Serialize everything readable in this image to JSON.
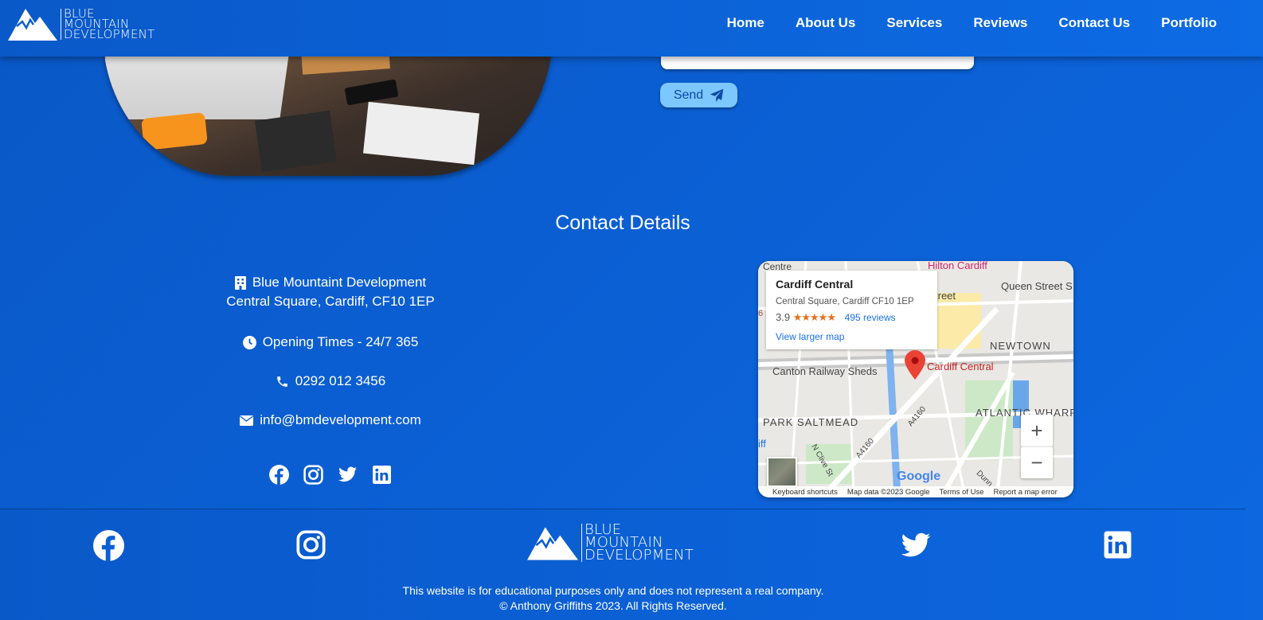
{
  "brand": {
    "line1": "BLUE",
    "line2": "MOUNTAIN",
    "line3": "DEVELOPMENT"
  },
  "nav": {
    "items": [
      "Home",
      "About Us",
      "Services",
      "Reviews",
      "Contact Us",
      "Portfolio"
    ]
  },
  "form": {
    "send_label": "Send"
  },
  "contact": {
    "title": "Contact Details",
    "company": "Blue Mountaint Development",
    "address": "Central Square, Cardiff, CF10 1EP",
    "opening": "Opening Times - 24/7 365",
    "phone": "0292 012 3456",
    "email": "info@bmdevelopment.com"
  },
  "map": {
    "place_name": "Cardiff Central",
    "place_address": "Central Square, Cardiff CF10 1EP",
    "rating": "3.9",
    "stars": "★★★★★",
    "reviews": "495 reviews",
    "larger_map": "View larger map",
    "labels": {
      "hilton": "Hilton Cardiff",
      "queen_street": "Queen Street S",
      "street": "treet",
      "centre": "Centre",
      "newtown": "NEWTOWN",
      "canton": "Canton Railway Sheds",
      "cardiff_central": "Cardiff Central",
      "park": "PARK SALTMEAD",
      "atlantic": "ATLANTIC WHARF",
      "a4160": "A4160",
      "a4160b": "A4160",
      "nclive": "N Clive St",
      "dunn": "Dunn",
      "diff": "iff",
      "six": "6"
    },
    "google": "Google",
    "footer": [
      "Keyboard shortcuts",
      "Map data ©2023 Google",
      "Terms of Use",
      "Report a map error"
    ],
    "zoom_in": "+",
    "zoom_out": "−"
  },
  "footer": {
    "legal1": "This website is for educational purposes only and does not represent a real company.",
    "legal2": "© Anthony Griffiths 2023. All Rights Reserved."
  },
  "colors": {
    "primary": "#0b5fd3",
    "send_button": "#7dc7ff",
    "pin": "#ea4335"
  },
  "icons": [
    "building-icon",
    "clock-icon",
    "phone-icon",
    "envelope-icon",
    "facebook-icon",
    "instagram-icon",
    "twitter-icon",
    "linkedin-icon",
    "paper-plane-icon",
    "mountain-logo-icon",
    "map-pin-icon"
  ]
}
